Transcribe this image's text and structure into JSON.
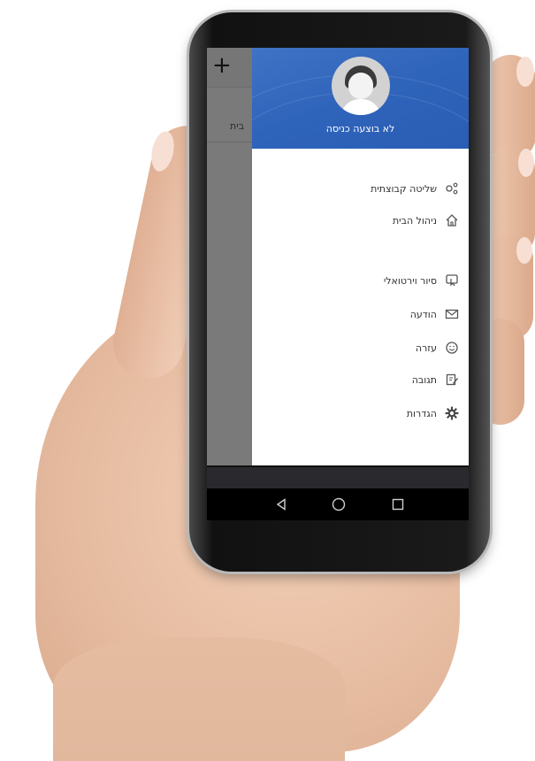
{
  "background_app": {
    "add_label": "+",
    "row_text": "בית"
  },
  "drawer": {
    "user_status": "לא בוצעה כניסה",
    "items": [
      {
        "label": "שליטה קבוצתית",
        "icon": "group-control-icon"
      },
      {
        "label": "ניהול הבית",
        "icon": "home-icon"
      },
      {
        "label": "סיור וירטואלי",
        "icon": "virtual-tour-icon"
      },
      {
        "label": "הודעה",
        "icon": "mail-icon"
      },
      {
        "label": "עזרה",
        "icon": "smiley-icon"
      },
      {
        "label": "תגובה",
        "icon": "feedback-icon"
      },
      {
        "label": "הגדרות",
        "icon": "gear-icon"
      }
    ]
  },
  "navigation_bar": {
    "buttons": [
      "back-icon",
      "home-circle-icon",
      "recents-icon"
    ]
  },
  "colors": {
    "drawer_header": "#2f64bb",
    "icon_gray": "#555555",
    "navbar": "#000000"
  }
}
